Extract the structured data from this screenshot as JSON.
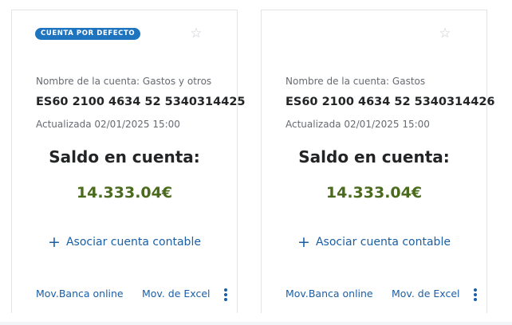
{
  "cards": [
    {
      "badge": "CUENTA POR DEFECTO",
      "favorite_icon": "☆",
      "account_name": "Nombre de la cuenta: Gastos y otros",
      "iban": "ES60 2100 4634 52 5340314425",
      "updated": "Actualizada 02/01/2025 15:00",
      "balance_label": "Saldo en cuenta:",
      "balance_value": "14.333.04€",
      "associate_icon": "+",
      "associate_label": "Asociar cuenta contable",
      "link_online": "Mov.Banca online",
      "link_excel": "Mov. de Excel"
    },
    {
      "favorite_icon": "☆",
      "account_name": "Nombre de la cuenta: Gastos",
      "iban": "ES60 2100 4634 52 5340314426",
      "updated": "Actualizada 02/01/2025 15:00",
      "balance_label": "Saldo en cuenta:",
      "balance_value": "14.333.04€",
      "associate_icon": "+",
      "associate_label": "Asociar cuenta contable",
      "link_online": "Mov.Banca online",
      "link_excel": "Mov. de Excel"
    }
  ],
  "colors": {
    "badge_bg": "#1f74c0",
    "balance": "#4a6b1d",
    "link": "#1a5fa6",
    "text_dark": "#222426",
    "text_muted": "#666a70"
  },
  "icons": {
    "favorite": "star-outline-icon",
    "associate": "plus-icon",
    "more": "kebab-menu-icon"
  }
}
